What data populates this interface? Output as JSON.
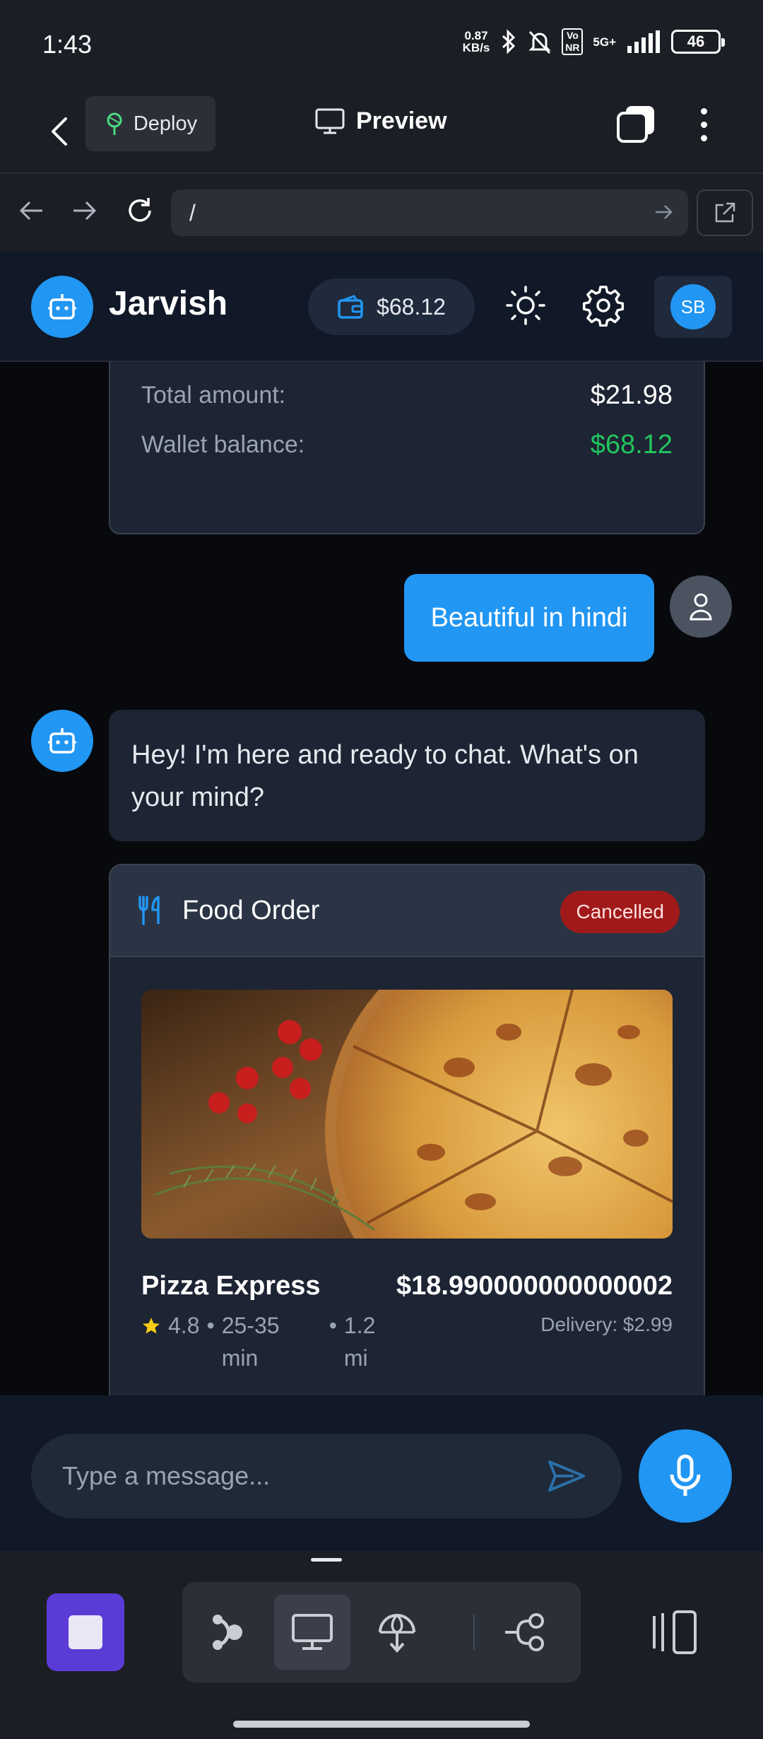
{
  "status_bar": {
    "time": "1:43",
    "net_speed_value": "0.87",
    "net_speed_unit": "KB/s",
    "volte": "Vo NR",
    "network": "5G+",
    "battery": "46"
  },
  "top_bar": {
    "deploy_label": "Deploy",
    "preview_label": "Preview"
  },
  "browser": {
    "url": "/"
  },
  "app_header": {
    "brand": "Jarvish",
    "wallet_balance": "$68.12",
    "user_initials": "SB"
  },
  "summary_card": {
    "rows": [
      {
        "label": "Total amount:",
        "value": "$21.98"
      },
      {
        "label": "Wallet balance:",
        "value": "$68.12"
      }
    ]
  },
  "messages": {
    "user_text": "Beautiful in hindi",
    "bot_text": "Hey! I'm here and ready to chat. What's on your mind?"
  },
  "order_card": {
    "title": "Food Order",
    "status": "Cancelled",
    "restaurant": "Pizza Express",
    "price": "$18.990000000000002",
    "rating": "4.8",
    "time": "25-35 min",
    "distance": "1.2 mi",
    "delivery": "Delivery: $2.99"
  },
  "composer": {
    "placeholder": "Type a message..."
  },
  "colors": {
    "accent": "#2196f3",
    "positive": "#22c55e",
    "cancel": "#a11a1a",
    "stop": "#5b3bd6"
  },
  "icons": [
    "back-icon",
    "deploy-icon",
    "monitor-icon",
    "tabs-icon",
    "more-icon",
    "arrow-left-icon",
    "arrow-right-icon",
    "reload-icon",
    "go-icon",
    "external-link-icon",
    "robot-icon",
    "wallet-icon",
    "sun-icon",
    "gear-icon",
    "user-icon",
    "utensils-icon",
    "star-icon",
    "send-icon",
    "mic-icon",
    "stop-icon",
    "agent-icon",
    "desktop-icon",
    "globe-icon",
    "share-icon",
    "side-panel-icon"
  ]
}
